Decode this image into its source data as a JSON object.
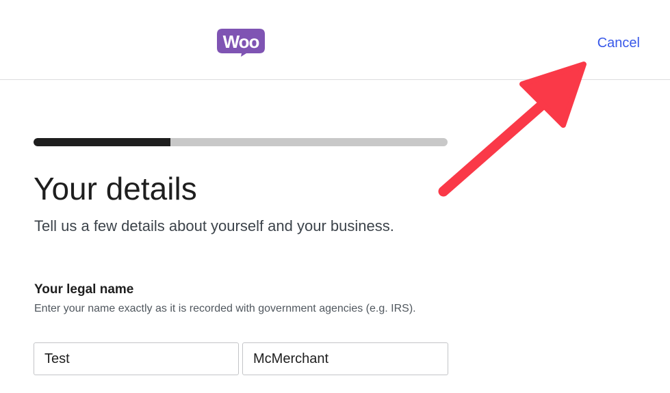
{
  "header": {
    "logo_text": "Woo",
    "cancel_label": "Cancel"
  },
  "progress": {
    "fraction": 0.33
  },
  "main": {
    "title": "Your details",
    "subtitle": "Tell us a few details about yourself and your business."
  },
  "legal_name": {
    "label": "Your legal name",
    "help": "Enter your name exactly as it is recorded with government agencies (e.g. IRS).",
    "first_name_value": "Test",
    "last_name_value": "McMerchant"
  },
  "colors": {
    "brand": "#7f54b3",
    "link": "#3858e9",
    "annotation_arrow": "#fa3948"
  },
  "icons": {
    "logo": "woo-logo-icon",
    "annotation": "red-arrow-icon"
  }
}
